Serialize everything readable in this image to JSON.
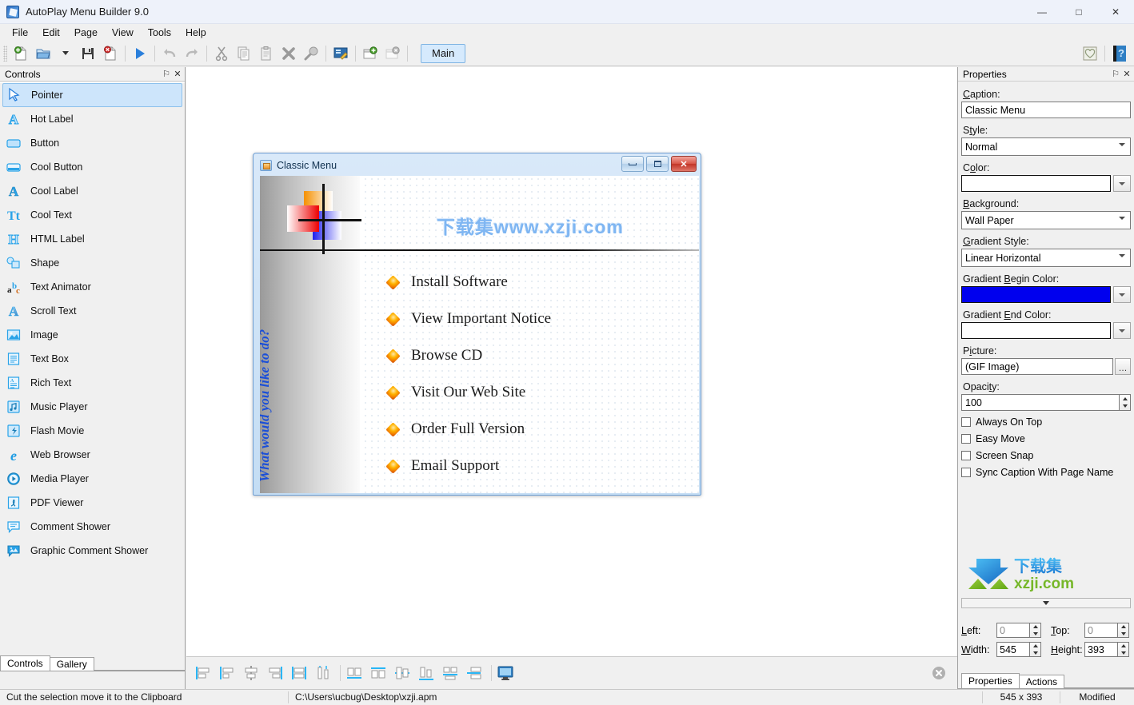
{
  "window": {
    "title": "AutoPlay Menu Builder 9.0",
    "app_icon": "app-icon",
    "minimize": "—",
    "maximize": "□",
    "close": "✕"
  },
  "menubar": {
    "items": [
      "File",
      "Edit",
      "Page",
      "View",
      "Tools",
      "Help"
    ]
  },
  "toolbar": {
    "buttons": [
      "new-icon",
      "open-icon",
      "open-dropdown-icon",
      "save-icon",
      "close-doc-icon",
      "run-icon",
      "undo-icon",
      "redo-icon",
      "cut-icon",
      "copy-icon",
      "paste-icon",
      "delete-icon",
      "properties-icon",
      "preview-icon",
      "add-page-icon",
      "remove-page-icon"
    ],
    "page_tab": "Main",
    "right_buttons": [
      "favorite-icon",
      "help-icon"
    ]
  },
  "controls_panel": {
    "title": "Controls",
    "pin": "⚐",
    "close": "✕",
    "items": [
      {
        "label": "Pointer",
        "icon": "pointer-icon",
        "selected": true
      },
      {
        "label": "Hot Label",
        "icon": "hot-label-icon",
        "selected": false
      },
      {
        "label": "Button",
        "icon": "button-icon",
        "selected": false
      },
      {
        "label": "Cool Button",
        "icon": "cool-button-icon",
        "selected": false
      },
      {
        "label": "Cool Label",
        "icon": "cool-label-icon",
        "selected": false
      },
      {
        "label": "Cool Text",
        "icon": "cool-text-icon",
        "selected": false
      },
      {
        "label": "HTML Label",
        "icon": "html-label-icon",
        "selected": false
      },
      {
        "label": "Shape",
        "icon": "shape-icon",
        "selected": false
      },
      {
        "label": "Text Animator",
        "icon": "text-animator-icon",
        "selected": false
      },
      {
        "label": "Scroll Text",
        "icon": "scroll-text-icon",
        "selected": false
      },
      {
        "label": "Image",
        "icon": "image-icon",
        "selected": false
      },
      {
        "label": "Text Box",
        "icon": "text-box-icon",
        "selected": false
      },
      {
        "label": "Rich Text",
        "icon": "rich-text-icon",
        "selected": false
      },
      {
        "label": "Music Player",
        "icon": "music-player-icon",
        "selected": false
      },
      {
        "label": "Flash Movie",
        "icon": "flash-movie-icon",
        "selected": false
      },
      {
        "label": "Web Browser",
        "icon": "web-browser-icon",
        "selected": false
      },
      {
        "label": "Media Player",
        "icon": "media-player-icon",
        "selected": false
      },
      {
        "label": "PDF Viewer",
        "icon": "pdf-viewer-icon",
        "selected": false
      },
      {
        "label": "Comment Shower",
        "icon": "comment-shower-icon",
        "selected": false
      },
      {
        "label": "Graphic Comment Shower",
        "icon": "graphic-comment-shower-icon",
        "selected": false
      }
    ],
    "tabs": [
      {
        "label": "Controls",
        "active": true
      },
      {
        "label": "Gallery",
        "active": false
      }
    ]
  },
  "design": {
    "caption": "Classic Menu",
    "titlebar_buttons": [
      "minimize",
      "maximize",
      "close"
    ],
    "watermark": "下载集www.xzji.com",
    "side_text": "What would you like to do?",
    "menu_items": [
      "Install Software",
      "View Important Notice",
      "Browse CD",
      "Visit Our Web Site",
      "Order Full Version",
      "Email Support"
    ]
  },
  "align_toolbar": {
    "buttons": [
      "align-left-icon",
      "align-left-edges-icon",
      "align-center-vertical-icon",
      "align-right-icon",
      "align-middle-icon",
      "align-tops-icon",
      "space-across-icon",
      "space-down-icon",
      "center-horizontally-icon",
      "center-bottom-icon",
      "make-same-size-icon",
      "stack-icon",
      "preview-screen-icon"
    ],
    "close_button": "close-circle-icon"
  },
  "properties": {
    "title": "Properties",
    "pin": "⚐",
    "close": "✕",
    "caption_label": "Caption:",
    "caption_value": "Classic Menu",
    "style_label": "Style:",
    "style_value": "Normal",
    "color_label": "Color:",
    "color_value": "#FFFFFF",
    "background_label": "Background:",
    "background_value": "Wall Paper",
    "gradient_style_label": "Gradient Style:",
    "gradient_style_value": "Linear Horizontal",
    "gradient_begin_label": "Gradient Begin Color:",
    "gradient_begin_value": "#0000EE",
    "gradient_end_label": "Gradient End Color:",
    "gradient_end_value": "#FFFFFF",
    "picture_label": "Picture:",
    "picture_value": "(GIF Image)",
    "picture_browse": "…",
    "opacity_label": "Opacity:",
    "opacity_value": "100",
    "checkboxes": [
      {
        "label": "Always On Top",
        "checked": false
      },
      {
        "label": "Easy Move",
        "checked": false
      },
      {
        "label": "Screen Snap",
        "checked": false
      },
      {
        "label": "Sync Caption With Page Name",
        "checked": false
      }
    ],
    "geometry": {
      "left_label": "Left:",
      "left_value": "0",
      "top_label": "Top:",
      "top_value": "0",
      "width_label": "Width:",
      "width_value": "545",
      "height_label": "Height:",
      "height_value": "393"
    },
    "tabs": [
      {
        "label": "Properties",
        "active": true
      },
      {
        "label": "Actions",
        "active": false
      }
    ],
    "logo_alt": "xzji-logo"
  },
  "statusbar": {
    "hint": "Cut the selection move it to the Clipboard",
    "file_path": "C:\\Users\\ucbug\\Desktop\\xzji.apm",
    "size": "545 x 393",
    "state": "Modified"
  }
}
